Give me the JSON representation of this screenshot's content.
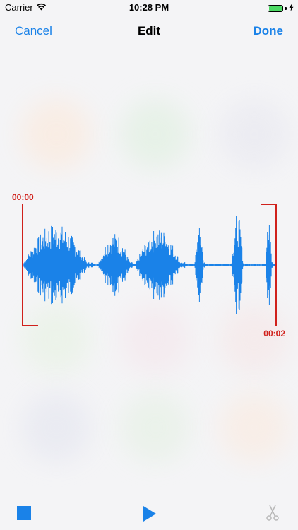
{
  "status_bar": {
    "carrier": "Carrier",
    "time": "10:28 PM",
    "battery_color": "#4cd964"
  },
  "nav": {
    "cancel_label": "Cancel",
    "title": "Edit",
    "done_label": "Done"
  },
  "editor": {
    "start_time": "00:00",
    "end_time": "00:02"
  },
  "toolbar": {
    "stop_icon": "stop-icon",
    "play_icon": "play-icon",
    "trim_icon": "scissors-icon"
  },
  "colors": {
    "accent": "#1a82e8",
    "waveform": "#1a82e8",
    "selection": "#d0211c",
    "disabled": "#b8b8b8"
  }
}
